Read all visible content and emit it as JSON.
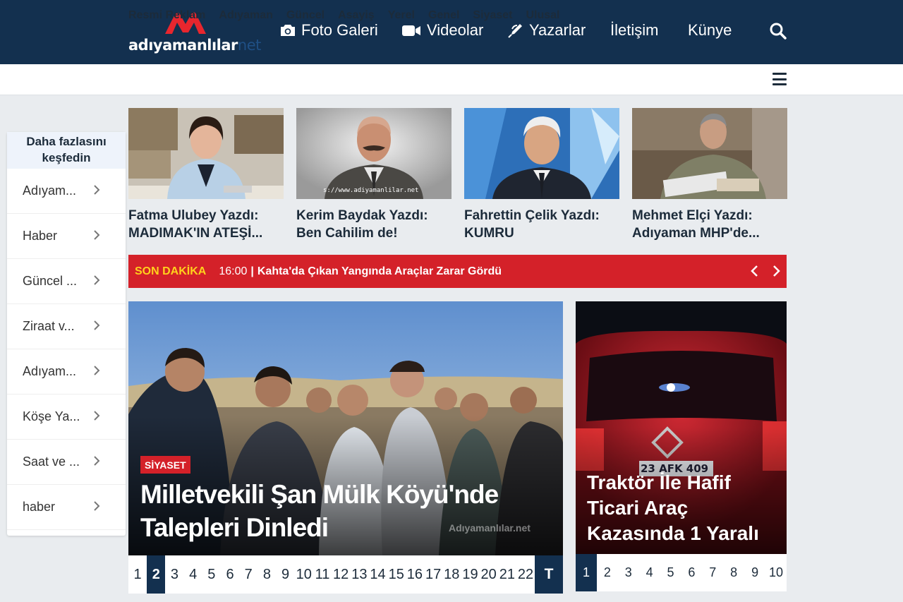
{
  "site": {
    "logo_text": "adıyamanlılar",
    "logo_suffix": "net",
    "brand_color": "#13304f",
    "accent_color": "#d42129"
  },
  "topnav": [
    {
      "label": "Foto Galeri",
      "icon": "camera-icon"
    },
    {
      "label": "Videolar",
      "icon": "video-icon"
    },
    {
      "label": "Yazarlar",
      "icon": "pen-icon"
    },
    {
      "label": "İletişim"
    },
    {
      "label": "Künye"
    }
  ],
  "categories": [
    "Resmi Reklam",
    "Adıyaman",
    "Güncel",
    "Asayiş",
    "Yerel",
    "Genel",
    "Siyaset",
    "Ulusal"
  ],
  "sidebar": {
    "heading": "Daha fazlasını keşfedin",
    "items": [
      "Adıyam...",
      "Haber",
      "Güncel ...",
      "Ziraat v...",
      "Adıyam...",
      "Köşe Ya...",
      "Saat ve ...",
      "haber"
    ]
  },
  "authors": [
    {
      "title": "Fatma Ulubey Yazdı: MADIMAK'IN ATEŞİ..."
    },
    {
      "title": "Kerim Baydak Yazdı: Ben Cahilim de!",
      "photo_caption": "s://www.adiyamanlilar.net"
    },
    {
      "title": "Fahrettin Çelik Yazdı: KUMRU"
    },
    {
      "title": "Mehmet Elçi Yazdı: Adıyaman MHP'de..."
    }
  ],
  "ticker": {
    "label": "SON DAKİKA",
    "time": "16:00",
    "separator": "|",
    "headline": "Kahta'da Çıkan Yangında Araçlar Zarar Gördü"
  },
  "main_story": {
    "category": "SİYASET",
    "title": "Milletvekili Şan Mülk Köyü'nde Talepleri Dinledi",
    "watermark": "Adıyamanlılar.net"
  },
  "main_pager": {
    "pages": [
      "1",
      "2",
      "3",
      "4",
      "5",
      "6",
      "7",
      "8",
      "9",
      "10",
      "11",
      "12",
      "13",
      "14",
      "15",
      "16",
      "17",
      "18",
      "19",
      "20",
      "21",
      "22"
    ],
    "active": "2",
    "more_label": "T"
  },
  "second_story": {
    "title": "Traktör İle Hafif Ticari Araç Kazasında 1 Yaralı",
    "plate": "23 AFK 409"
  },
  "second_pager": {
    "pages": [
      "1",
      "2",
      "3",
      "4",
      "5",
      "6",
      "7",
      "8",
      "9",
      "10"
    ],
    "active": "1"
  }
}
